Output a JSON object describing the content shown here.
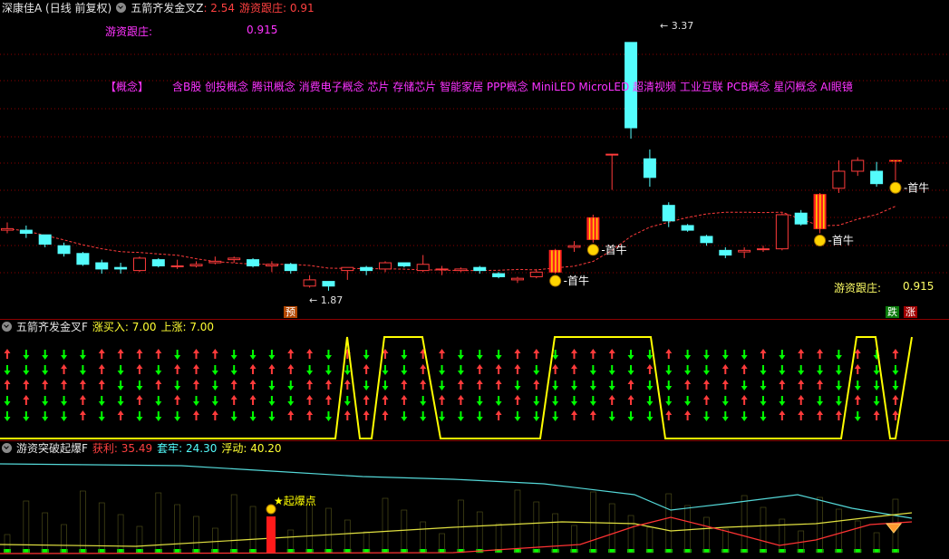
{
  "colors": {
    "up": "#ff3b3b",
    "down": "#54fcfc",
    "bg": "#000000",
    "grid": "#8b0000",
    "ma": "#ff3b3b",
    "magenta": "#ff33ff",
    "yellow": "#ffff00",
    "green": "#00ff00",
    "gold": "#ffd400"
  },
  "header1": {
    "stock": "深康佳A (日线 前复权)",
    "indicator": "五箭齐发金叉Z",
    "value": ": 2.54",
    "label2": "游资跟庄: 0.91"
  },
  "anno": {
    "youzi_label": "游资跟庄:",
    "youzi_value": "0.915",
    "concept_label": "【概念】",
    "concepts": "含B股 创投概念 腾讯概念 消费电子概念 芯片 存储芯片 智能家居 PPP概念 MiniLED MicroLED 超清视频 工业互联 PCB概念 星闪概念 AI眼镜",
    "high": "3.37",
    "low": "1.87",
    "yu": "预",
    "die": "跌",
    "zhang": "涨",
    "first_bull": "首牛",
    "youzi_label2": "游资跟庄:",
    "youzi_value2": "0.915"
  },
  "header2": {
    "indicator": "五箭齐发金叉F",
    "label": "涨买入: 7.00",
    "label2": "上涨: 7.00"
  },
  "header3": {
    "indicator": "游资突破起爆F",
    "profit": "获利: 35.49",
    "trapped": "套牢: 24.30",
    "float": "浮动: 40.20",
    "burst": "起爆点"
  },
  "chart_data": [
    {
      "type": "candlestick",
      "ylim": [
        1.6,
        3.55
      ],
      "candles": [
        [
          2.16,
          2.17,
          2.21,
          2.14
        ],
        [
          2.16,
          2.14,
          2.19,
          2.11
        ],
        [
          2.13,
          2.07,
          2.13,
          2.05
        ],
        [
          2.06,
          2.01,
          2.08,
          1.99
        ],
        [
          2.01,
          1.94,
          2.02,
          1.93
        ],
        [
          1.95,
          1.91,
          1.97,
          1.88
        ],
        [
          1.92,
          1.91,
          1.95,
          1.88
        ],
        [
          1.9,
          1.98,
          1.99,
          1.89
        ],
        [
          1.97,
          1.93,
          1.98,
          1.92
        ],
        [
          1.93,
          1.93,
          1.97,
          1.91
        ],
        [
          1.93,
          1.94,
          1.96,
          1.92
        ],
        [
          1.95,
          1.96,
          1.99,
          1.94
        ],
        [
          1.97,
          1.98,
          1.99,
          1.95
        ],
        [
          1.97,
          1.93,
          1.98,
          1.92
        ],
        [
          1.93,
          1.94,
          1.96,
          1.89
        ],
        [
          1.94,
          1.9,
          1.95,
          1.88
        ],
        [
          1.8,
          1.84,
          1.87,
          1.79
        ],
        [
          1.83,
          1.8,
          1.83,
          1.77
        ],
        [
          1.9,
          1.92,
          1.92,
          1.84
        ],
        [
          1.92,
          1.9,
          1.93,
          1.87
        ],
        [
          1.91,
          1.95,
          1.96,
          1.89
        ],
        [
          1.95,
          1.93,
          1.95,
          1.92
        ],
        [
          1.9,
          1.94,
          2.0,
          1.89
        ],
        [
          1.91,
          1.91,
          1.93,
          1.87
        ],
        [
          1.9,
          1.91,
          1.92,
          1.89
        ],
        [
          1.92,
          1.9,
          1.93,
          1.88
        ],
        [
          1.88,
          1.86,
          1.89,
          1.85
        ],
        [
          1.84,
          1.85,
          1.86,
          1.82
        ],
        [
          1.86,
          1.89,
          1.91,
          1.85
        ],
        [
          1.89,
          2.03,
          2.04,
          1.88
        ],
        [
          2.05,
          2.06,
          2.09,
          2.02
        ],
        [
          2.1,
          2.24,
          2.26,
          2.08
        ],
        [
          2.65,
          2.65,
          2.65,
          2.42
        ],
        [
          3.37,
          2.82,
          3.37,
          2.75
        ],
        [
          2.62,
          2.5,
          2.68,
          2.44
        ],
        [
          2.32,
          2.22,
          2.34,
          2.18
        ],
        [
          2.19,
          2.16,
          2.2,
          2.15
        ],
        [
          2.12,
          2.08,
          2.13,
          2.06
        ],
        [
          2.03,
          2.0,
          2.05,
          1.98
        ],
        [
          2.02,
          2.03,
          2.05,
          1.98
        ],
        [
          2.04,
          2.04,
          2.06,
          2.02
        ],
        [
          2.04,
          2.26,
          2.27,
          2.03
        ],
        [
          2.27,
          2.2,
          2.29,
          2.19
        ],
        [
          2.17,
          2.39,
          2.4,
          2.14
        ],
        [
          2.43,
          2.54,
          2.61,
          2.4
        ],
        [
          2.54,
          2.61,
          2.63,
          2.51
        ],
        [
          2.54,
          2.46,
          2.6,
          2.44
        ],
        [
          2.61,
          2.61,
          2.61,
          2.48
        ]
      ],
      "first_bull": [
        29,
        31,
        43,
        47
      ]
    },
    {
      "type": "signal",
      "series": [
        {
          "name": "涨买入",
          "value": 7.0
        },
        {
          "name": "上涨",
          "value": 7.0
        }
      ]
    },
    {
      "type": "line",
      "series": [
        {
          "name": "获利",
          "value": 35.49
        },
        {
          "name": "套牢",
          "value": 24.3
        },
        {
          "name": "浮动",
          "value": 40.2
        }
      ]
    }
  ]
}
